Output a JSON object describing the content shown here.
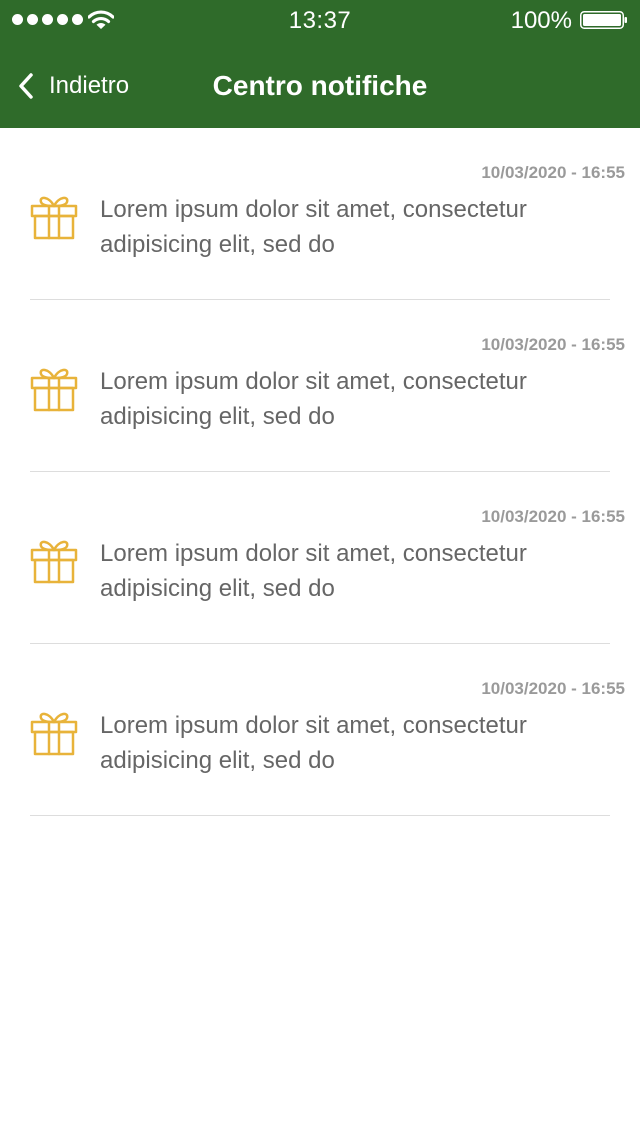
{
  "status_bar": {
    "time": "13:37",
    "battery_percent": "100%",
    "signal_bars": 5,
    "battery_level": 1.0
  },
  "nav": {
    "back_label": "Indietro",
    "title": "Centro notifiche"
  },
  "colors": {
    "header": "#2f6b2a",
    "gift_icon": "#e8b33a",
    "date_text": "#9a9a9a",
    "body_text": "#666666"
  },
  "notifications": [
    {
      "icon": "gift-icon",
      "date": "10/03/2020 - 16:55",
      "text_line1": "Lorem ipsum dolor sit amet, consectetur",
      "text_line2": "adipisicing elit, sed do"
    },
    {
      "icon": "gift-icon",
      "date": "10/03/2020 - 16:55",
      "text_line1": "Lorem ipsum dolor sit amet, consectetur",
      "text_line2": "adipisicing elit, sed do"
    },
    {
      "icon": "gift-icon",
      "date": "10/03/2020 - 16:55",
      "text_line1": "Lorem ipsum dolor sit amet, consectetur",
      "text_line2": "adipisicing elit, sed do"
    },
    {
      "icon": "gift-icon",
      "date": "10/03/2020 - 16:55",
      "text_line1": "Lorem ipsum dolor sit amet, consectetur",
      "text_line2": "adipisicing elit, sed do"
    }
  ]
}
